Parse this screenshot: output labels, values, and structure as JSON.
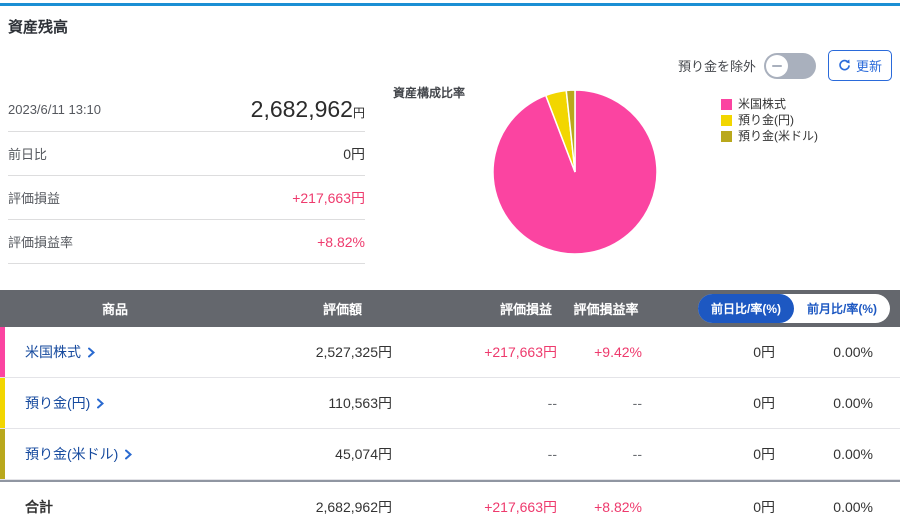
{
  "page": {
    "title": "資産残高"
  },
  "controls": {
    "toggle_label": "預り金を除外",
    "toggle_state": "off",
    "refresh_label": "更新"
  },
  "summary": {
    "timestamp": "2023/6/11 13:10",
    "total_value": "2,682,962",
    "total_unit": "円",
    "rows": [
      {
        "label": "前日比",
        "value": "0円",
        "color": "dark"
      },
      {
        "label": "評価損益",
        "value": "+217,663円",
        "color": "red"
      },
      {
        "label": "評価損益率",
        "value": "+8.82%",
        "color": "red"
      }
    ]
  },
  "chart_data": {
    "type": "pie",
    "title": "資産構成比率",
    "labels": [
      "米国株式",
      "預り金(円)",
      "預り金(米ドル)"
    ],
    "values": [
      94.2,
      4.1,
      1.7
    ],
    "colors": [
      "#fb44a1",
      "#f2d600",
      "#b9a81c"
    ],
    "legend_position": "right",
    "start_angle": "12 o'clock, clockwise"
  },
  "table": {
    "headers": [
      "商品",
      "評価額",
      "評価損益",
      "評価損益率"
    ],
    "rate_toggle": {
      "selected": "前日比/率(%)",
      "unselected": "前月比/率(%)"
    },
    "rows": [
      {
        "name": "米国株式",
        "bar_color": "#fb44a1",
        "value": "2,527,325円",
        "pl": "+217,663円",
        "pl_rate": "+9.42%",
        "day_change": "0円",
        "day_rate": "0.00%",
        "pl_positive": true
      },
      {
        "name": "預り金(円)",
        "bar_color": "#f2d600",
        "value": "110,563円",
        "pl": "--",
        "pl_rate": "--",
        "day_change": "0円",
        "day_rate": "0.00%",
        "pl_positive": false
      },
      {
        "name": "預り金(米ドル)",
        "bar_color": "#b9a81c",
        "value": "45,074円",
        "pl": "--",
        "pl_rate": "--",
        "day_change": "0円",
        "day_rate": "0.00%",
        "pl_positive": false
      }
    ],
    "total": {
      "name": "合計",
      "value": "2,682,962円",
      "pl": "+217,663円",
      "pl_rate": "+8.82%",
      "day_change": "0円",
      "day_rate": "0.00%"
    }
  },
  "colors": {
    "accent_line": "#1b8fd4",
    "positive_text": "#ee3a6d",
    "link_text": "#164a9e",
    "header_bg": "#64676d",
    "pill_blue": "#1d58c2",
    "button_blue": "#2a6ada",
    "toggle_gray": "#a9b0bd"
  }
}
